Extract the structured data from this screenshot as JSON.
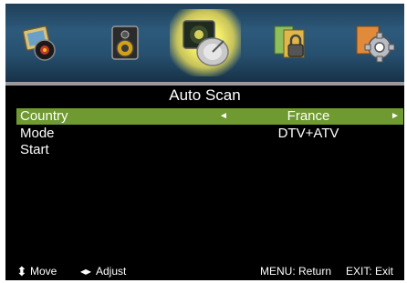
{
  "menu": {
    "tabs": [
      {
        "name": "picture",
        "icon": "picture-icon"
      },
      {
        "name": "sound",
        "icon": "speaker-icon"
      },
      {
        "name": "channel",
        "icon": "satellite-dish-icon",
        "active": true
      },
      {
        "name": "lock",
        "icon": "lock-icon"
      },
      {
        "name": "setup",
        "icon": "gear-icon"
      }
    ],
    "title": "Auto Scan",
    "items": [
      {
        "label": "Country",
        "value": "France",
        "selected": true
      },
      {
        "label": "Mode",
        "value": "DTV+ATV"
      },
      {
        "label": "Start",
        "value": ""
      }
    ],
    "arrows": {
      "left": "◄",
      "right": "►"
    }
  },
  "footer": {
    "move_icon": "⬍",
    "move": "Move",
    "adjust_icon": "◂▸",
    "adjust": "Adjust",
    "menu": "MENU: Return",
    "exit": "EXIT: Exit"
  },
  "colors": {
    "highlight": "#6f9a31",
    "iconbar": "#2d5a7c"
  }
}
